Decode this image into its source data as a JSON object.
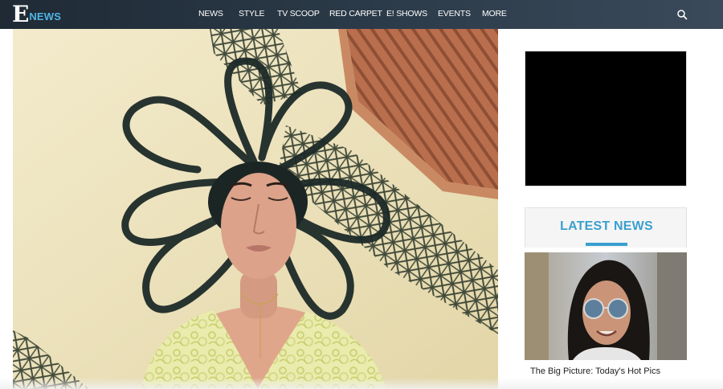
{
  "brand": {
    "logo_e": "E",
    "logo_news": "NEWS"
  },
  "nav": {
    "items": [
      {
        "label": "NEWS"
      },
      {
        "label": "STYLE"
      },
      {
        "label": "TV SCOOP"
      },
      {
        "label": "RED CARPET"
      },
      {
        "label": "E! SHOWS"
      },
      {
        "label": "EVENTS"
      },
      {
        "label": "MORE"
      }
    ],
    "search_icon": "search-icon"
  },
  "sidebar": {
    "latest_title": "LATEST NEWS",
    "news_items": [
      {
        "caption": "The Big Picture: Today's Hot Pics"
      }
    ]
  },
  "colors": {
    "header_bg": "#2b3a48",
    "accent": "#3b9fcf",
    "logo_news": "#4fb4e6"
  }
}
